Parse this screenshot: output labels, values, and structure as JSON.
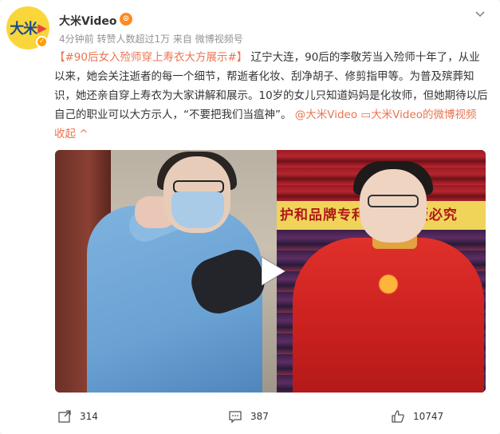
{
  "post": {
    "avatar": {
      "text": "大米",
      "mark": "▶"
    },
    "username": "大米Video",
    "vip_badge": "⊙",
    "meta": "4分钟前 转赞人数超过1万 来自 微博视频号",
    "content": {
      "topic": "【#90后女入殓师穿上寿衣大方展示#】",
      "body": "辽宁大连，90后的李敬芳当入殓师十年了，从业以来，她会关注逝者的每一个细节，帮逝者化妆、刮净胡子、修剪指甲等。为普及殡葬知识，她还亲自穿上寿衣为大家讲解和展示。10岁的女儿只知道妈妈是化妆师，但她期待以后自己的职业可以大方示人，“不要把我们当瘟神”。",
      "mention": "@大米Video",
      "video_link": "大米Video的微博视频",
      "collapse": "收起"
    },
    "media": {
      "banner_text": "护和品牌专利 坊，盗版必究"
    },
    "actions": {
      "repost_count": "314",
      "comment_count": "387",
      "like_count": "10747"
    },
    "colors": {
      "link": "#eb7350",
      "accent_avatar": "#f9d63a"
    }
  }
}
